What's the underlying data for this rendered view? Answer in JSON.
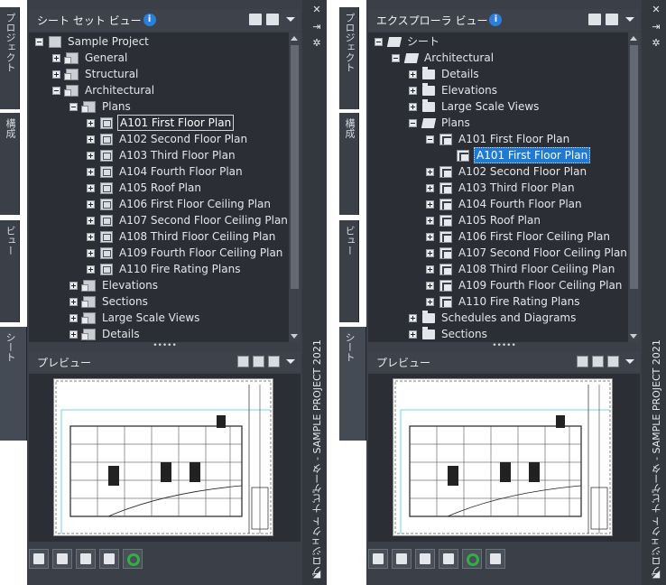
{
  "panel1": {
    "header_title": "シート セット ビュー",
    "side_tabs": [
      "プロジェクト",
      "構成",
      "ビュー",
      "シート"
    ],
    "tree": [
      {
        "label": "Sample Project",
        "level": 0,
        "exp": "minus",
        "icon": "proj"
      },
      {
        "label": "General",
        "level": 1,
        "exp": "plus",
        "icon": "set"
      },
      {
        "label": "Structural",
        "level": 1,
        "exp": "plus",
        "icon": "set"
      },
      {
        "label": "Architectural",
        "level": 1,
        "exp": "minus",
        "icon": "set"
      },
      {
        "label": "Plans",
        "level": 2,
        "exp": "minus",
        "icon": "set"
      },
      {
        "label": "A101 First Floor Plan",
        "level": 3,
        "exp": "plus",
        "icon": "sheet",
        "state": "sel"
      },
      {
        "label": "A102 Second Floor Plan",
        "level": 3,
        "exp": "plus",
        "icon": "sheet"
      },
      {
        "label": "A103 Third Floor Plan",
        "level": 3,
        "exp": "plus",
        "icon": "sheet"
      },
      {
        "label": "A104 Fourth Floor Plan",
        "level": 3,
        "exp": "plus",
        "icon": "sheet"
      },
      {
        "label": "A105 Roof Plan",
        "level": 3,
        "exp": "plus",
        "icon": "sheet"
      },
      {
        "label": "A106 First Floor Ceiling Plan",
        "level": 3,
        "exp": "plus",
        "icon": "sheet"
      },
      {
        "label": "A107 Second Floor Ceiling Plan",
        "level": 3,
        "exp": "plus",
        "icon": "sheet"
      },
      {
        "label": "A108 Third Floor Ceiling Plan",
        "level": 3,
        "exp": "plus",
        "icon": "sheet"
      },
      {
        "label": "A109 Fourth Floor Ceiling Plan",
        "level": 3,
        "exp": "plus",
        "icon": "sheet"
      },
      {
        "label": "A110 Fire Rating Plans",
        "level": 3,
        "exp": "plus",
        "icon": "sheet"
      },
      {
        "label": "Elevations",
        "level": 2,
        "exp": "plus",
        "icon": "set"
      },
      {
        "label": "Sections",
        "level": 2,
        "exp": "plus",
        "icon": "set"
      },
      {
        "label": "Large Scale Views",
        "level": 2,
        "exp": "plus",
        "icon": "set"
      },
      {
        "label": "Details",
        "level": 2,
        "exp": "plus",
        "icon": "set"
      }
    ],
    "preview_title": "プレビュー",
    "vertical_title": "プロジェクト ナビゲータ - SAMPLE PROJECT 2021",
    "bottom_buttons": [
      "publish-icon",
      "sheet-new-icon",
      "layout-icon",
      "table-icon",
      "refresh-icon"
    ]
  },
  "panel2": {
    "header_title": "エクスプローラ ビュー",
    "side_tabs": [
      "プロジェクト",
      "構成",
      "ビュー",
      "シート"
    ],
    "tree": [
      {
        "label": "シート",
        "level": 0,
        "exp": "minus",
        "icon": "ofolder"
      },
      {
        "label": "Architectural",
        "level": 1,
        "exp": "minus",
        "icon": "ofolder"
      },
      {
        "label": "Details",
        "level": 2,
        "exp": "plus",
        "icon": "folder"
      },
      {
        "label": "Elevations",
        "level": 2,
        "exp": "plus",
        "icon": "folder"
      },
      {
        "label": "Large Scale Views",
        "level": 2,
        "exp": "plus",
        "icon": "folder"
      },
      {
        "label": "Plans",
        "level": 2,
        "exp": "minus",
        "icon": "ofolder"
      },
      {
        "label": "A101 First Floor Plan",
        "level": 3,
        "exp": "minus",
        "icon": "dwg"
      },
      {
        "label": "A101 First Floor Plan",
        "level": 4,
        "exp": "none",
        "icon": "dwg",
        "state": "hl"
      },
      {
        "label": "A102 Second Floor Plan",
        "level": 3,
        "exp": "plus",
        "icon": "dwg"
      },
      {
        "label": "A103 Third Floor Plan",
        "level": 3,
        "exp": "plus",
        "icon": "dwg"
      },
      {
        "label": "A104 Fourth Floor Plan",
        "level": 3,
        "exp": "plus",
        "icon": "dwg"
      },
      {
        "label": "A105 Roof Plan",
        "level": 3,
        "exp": "plus",
        "icon": "dwg"
      },
      {
        "label": "A106 First Floor Ceiling Plan",
        "level": 3,
        "exp": "plus",
        "icon": "dwg"
      },
      {
        "label": "A107 Second Floor Ceiling Plan",
        "level": 3,
        "exp": "plus",
        "icon": "dwg"
      },
      {
        "label": "A108 Third Floor Ceiling Plan",
        "level": 3,
        "exp": "plus",
        "icon": "dwg"
      },
      {
        "label": "A109 Fourth Floor Ceiling Plan",
        "level": 3,
        "exp": "plus",
        "icon": "dwg"
      },
      {
        "label": "A110 Fire Rating Plans",
        "level": 3,
        "exp": "plus",
        "icon": "dwg"
      },
      {
        "label": "Schedules and Diagrams",
        "level": 2,
        "exp": "plus",
        "icon": "folder"
      },
      {
        "label": "Sections",
        "level": 2,
        "exp": "plus",
        "icon": "folder"
      }
    ],
    "preview_title": "プレビュー",
    "vertical_title": "プロジェクト ナビゲータ - SAMPLE PROJECT 2021",
    "bottom_buttons": [
      "new-folder-icon",
      "properties-icon",
      "layout-icon",
      "table-icon",
      "refresh-icon",
      "dwg-tool-icon"
    ]
  }
}
